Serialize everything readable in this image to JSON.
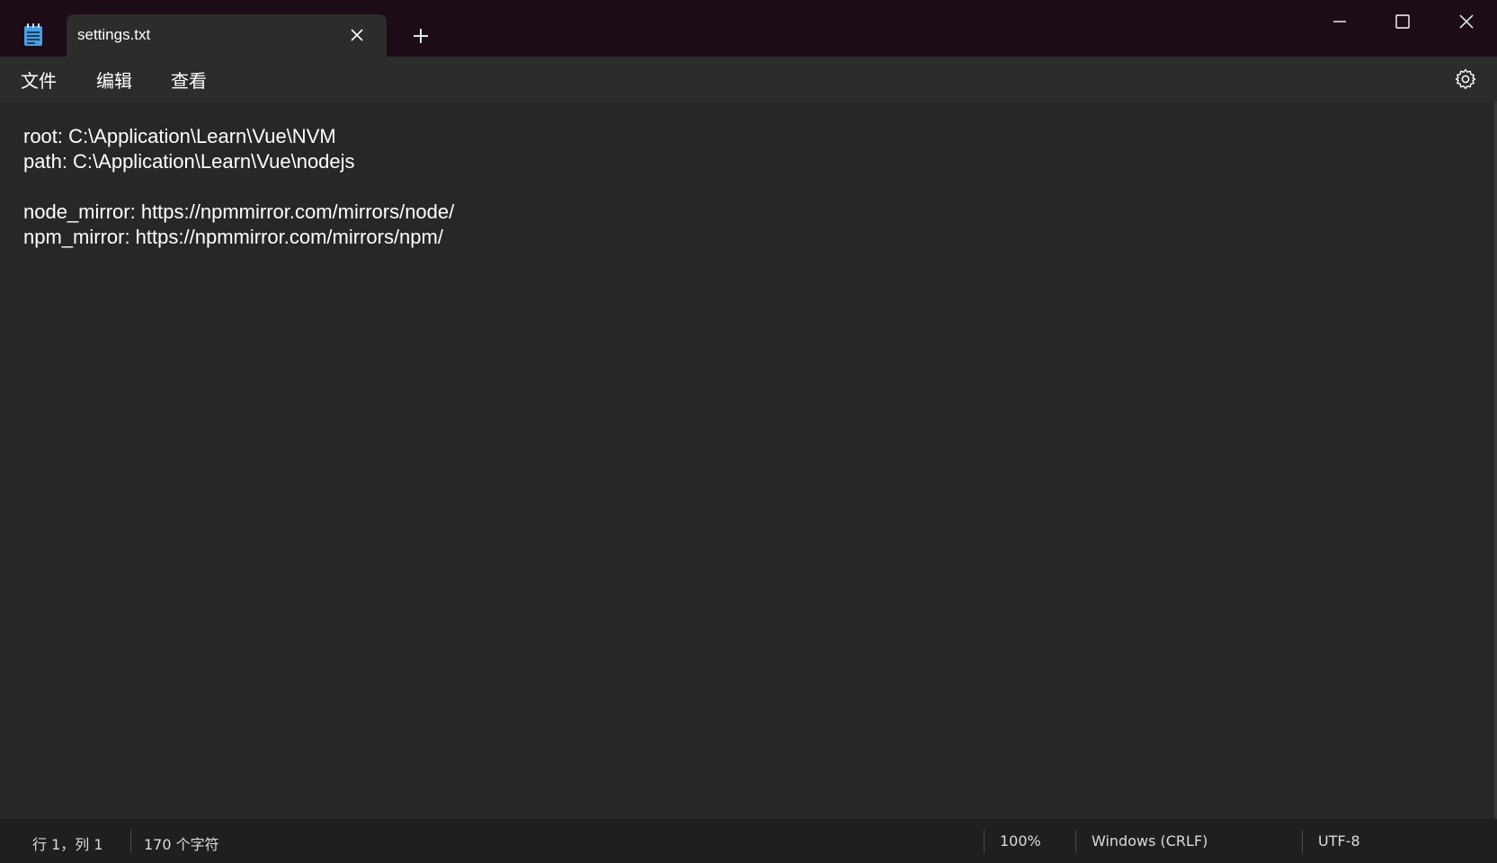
{
  "titlebar": {
    "app_icon": "notepad-icon",
    "tab_title": "settings.txt",
    "tab_close_icon": "close-icon",
    "new_tab_icon": "plus-icon",
    "window_controls": {
      "minimize_icon": "minimize-icon",
      "maximize_icon": "maximize-icon",
      "close_icon": "close-icon"
    }
  },
  "menubar": {
    "file_label": "文件",
    "edit_label": "编辑",
    "view_label": "查看",
    "settings_icon": "gear-icon"
  },
  "editor": {
    "lines": [
      "root: C:\\Application\\Learn\\Vue\\NVM",
      "path: C:\\Application\\Learn\\Vue\\nodejs",
      "",
      "node_mirror: https://npmmirror.com/mirrors/node/",
      "npm_mirror: https://npmmirror.com/mirrors/npm/"
    ]
  },
  "statusbar": {
    "position": "行 1，列 1",
    "char_count": "170 个字符",
    "zoom": "100%",
    "line_ending": "Windows (CRLF)",
    "encoding": "UTF-8"
  },
  "colors": {
    "titlebar_bg": "#1b0c18",
    "editor_bg": "#272727",
    "tab_bg": "#2c2c2c",
    "statusbar_bg": "#1f1f1f",
    "text": "#ffffff",
    "notepad_icon": "#4a9fe0"
  }
}
